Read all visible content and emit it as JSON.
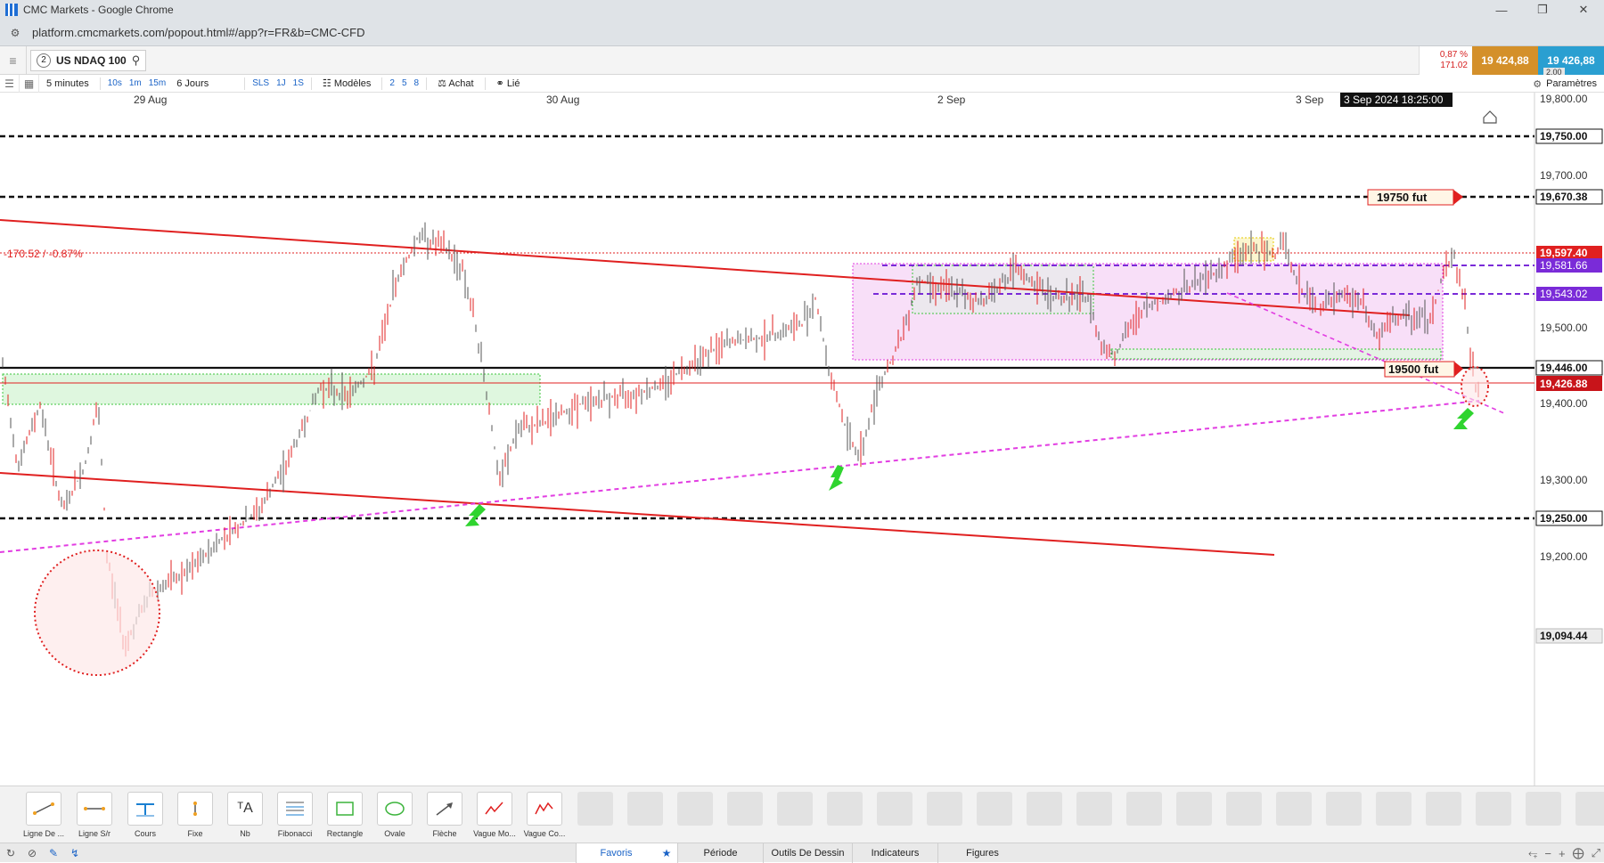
{
  "window": {
    "title": "CMC Markets - Google Chrome",
    "url": "platform.cmcmarkets.com/popout.html#/app?r=FR&b=CMC-CFD"
  },
  "instrument": {
    "count": "2",
    "name": "US NDAQ 100"
  },
  "prices": {
    "change_pct": "0,87 %",
    "change_abs": "171.02",
    "sell": "19 424,88",
    "buy": "19 426,88",
    "spread": "2.00"
  },
  "toolbar": {
    "interval": "5 minutes",
    "quick_intervals": [
      "10s",
      "1m",
      "15m"
    ],
    "period": "6 Jours",
    "sls": [
      "SLS",
      "1J",
      "1S"
    ],
    "models_label": "Modèles",
    "model_nums": [
      "2",
      "5",
      "8"
    ],
    "achat_label": "Achat",
    "lie_label": "Lié",
    "settings_label": "Paramètres"
  },
  "chart": {
    "date_labels": [
      "29 Aug",
      "30 Aug",
      "2 Sep",
      "3 Sep"
    ],
    "cursor_label": "3 Sep 2024 18:25:00",
    "price_ticks": [
      "19,800.00",
      "19,700.00",
      "19,500.00",
      "19,400.00",
      "19,300.00",
      "19,200.00"
    ],
    "price_tags": [
      {
        "label": "19,750.00",
        "kind": "level"
      },
      {
        "label": "19,670.38",
        "kind": "level"
      },
      {
        "label": "19,597.40",
        "kind": "prev_close"
      },
      {
        "label": "19,581.66",
        "kind": "purple"
      },
      {
        "label": "19,543.02",
        "kind": "purple"
      },
      {
        "label": "19,446.00",
        "kind": "level"
      },
      {
        "label": "19,426.88",
        "kind": "current"
      },
      {
        "label": "19,250.00",
        "kind": "level"
      },
      {
        "label": "19,094.44",
        "kind": "low"
      }
    ],
    "change_label": "-170.52 / -0.87%",
    "annotations": [
      "19750  fut",
      "19500  fut"
    ],
    "colors": {
      "red": "#e02020",
      "magenta": "#e23ee2",
      "purple": "#7a2bd8",
      "green_zone": "#9be89b",
      "arrow": "#2fd42f"
    }
  },
  "chart_data": {
    "type": "line",
    "title": "",
    "xlabel": "",
    "ylabel": "",
    "x": [
      "29 Aug",
      "30 Aug",
      "2 Sep",
      "3 Sep 2024 18:25:00"
    ],
    "ylim": [
      19050,
      19850
    ],
    "series": [
      {
        "values": [
          19400,
          19290,
          19470,
          19426.88
        ]
      }
    ],
    "horizontal_levels": [
      19750,
      19670.38,
      19597.4,
      19581.66,
      19543.02,
      19446,
      19426.88,
      19250
    ]
  },
  "drawing_tools": [
    {
      "name": "ligne-de",
      "label": "Ligne De ..."
    },
    {
      "name": "ligne-sr",
      "label": "Ligne S/r"
    },
    {
      "name": "cours",
      "label": "Cours"
    },
    {
      "name": "fixe",
      "label": "Fixe"
    },
    {
      "name": "nb",
      "label": "Nb"
    },
    {
      "name": "fibonacci",
      "label": "Fibonacci"
    },
    {
      "name": "rectangle",
      "label": "Rectangle"
    },
    {
      "name": "ovale",
      "label": "Ovale"
    },
    {
      "name": "fleche",
      "label": "Flèche"
    },
    {
      "name": "vague-mo",
      "label": "Vague Mo..."
    },
    {
      "name": "vague-co",
      "label": "Vague Co..."
    }
  ],
  "bottom_tabs": [
    "Favoris",
    "Période",
    "Outils De Dessin",
    "Indicateurs",
    "Figures"
  ]
}
